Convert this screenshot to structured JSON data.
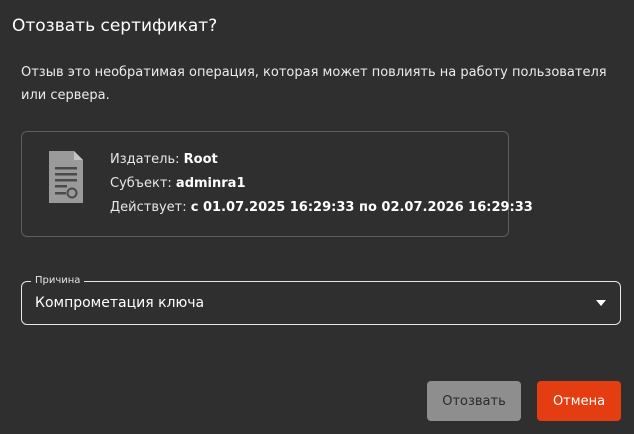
{
  "dialog": {
    "title": "Отозвать сертификат?",
    "warning": "Отзыв это необратимая операция, которая может повлиять на работу пользователя или сервера."
  },
  "certificate": {
    "icon": "certificate-document-icon",
    "issuer_label": "Издатель: ",
    "issuer_value": "Root",
    "subject_label": "Субъект: ",
    "subject_value": "adminra1",
    "valid_label": "Действует: ",
    "valid_value": "с 01.07.2025 16:29:33 по 02.07.2026 16:29:33"
  },
  "reason": {
    "label": "Причина",
    "selected": "Компрометация ключа"
  },
  "buttons": {
    "revoke": "Отозвать",
    "cancel": "Отмена"
  },
  "colors": {
    "background": "#2f2f2f",
    "card_border": "#5e5e5e",
    "revoke_button": "#8e8e8e",
    "cancel_button": "#e53d12"
  }
}
